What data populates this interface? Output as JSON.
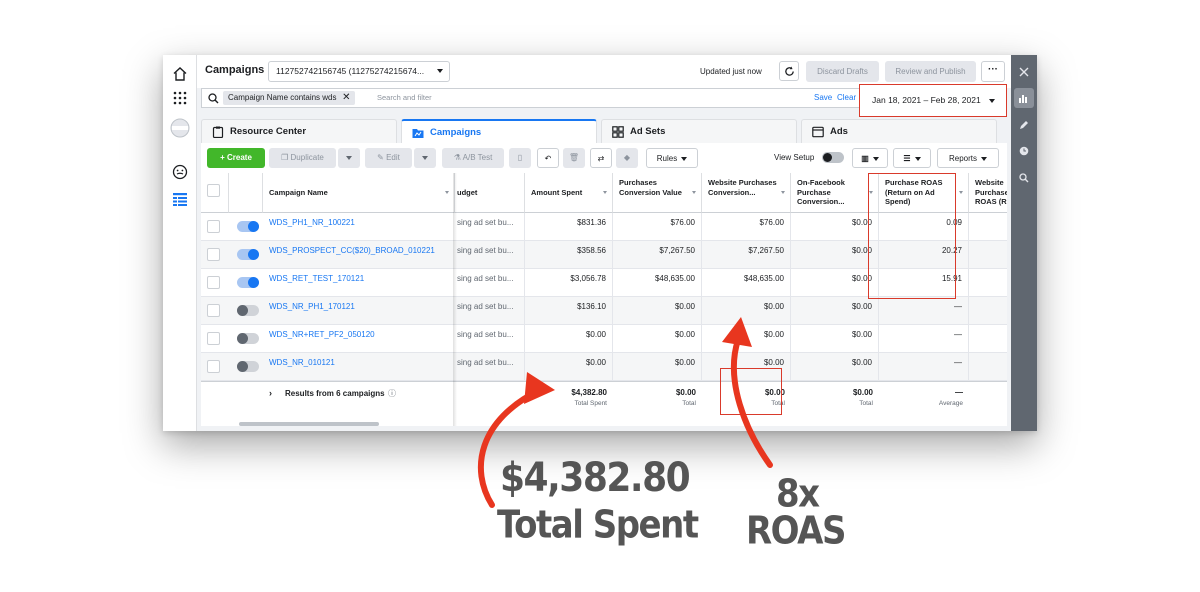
{
  "header": {
    "title": "Campaigns",
    "campaign_select": "112752742156745 (11275274215674...",
    "updated": "Updated just now",
    "discard": "Discard Drafts",
    "review": "Review and Publish",
    "more": "···"
  },
  "filter": {
    "chip": "Campaign Name contains wds",
    "placeholder": "Search and filter",
    "save": "Save",
    "clear": "Clear",
    "date_range": "Jan 18, 2021 – Feb 28, 2021"
  },
  "tabs": [
    {
      "label": "Resource Center"
    },
    {
      "label": "Campaigns"
    },
    {
      "label": "Ad Sets"
    },
    {
      "label": "Ads"
    }
  ],
  "toolbar": {
    "create": "+  Create",
    "duplicate": "Duplicate",
    "edit": "Edit",
    "ab_test": "A/B Test",
    "rules": "Rules",
    "view_setup": "View Setup",
    "reports": "Reports"
  },
  "columns": {
    "name": "Campaign Name",
    "budget": "udget",
    "amount": "Amount Spent",
    "pcv": "Purchases Conversion Value",
    "wpcv": "Website Purchases Conversion...",
    "ofp": "On-Facebook Purchase Conversion...",
    "roas": "Purchase ROAS (Return on Ad Spend)",
    "wroas": "Website Purchase ROAS (R"
  },
  "rows": [
    {
      "name": "WDS_PH1_NR_100221",
      "on": true,
      "budget": "sing ad set bu...",
      "amount": "$831.36",
      "pcv": "$76.00",
      "wpcv": "$76.00",
      "ofp": "$0.00",
      "roas": "0.09"
    },
    {
      "name": "WDS_PROSPECT_CC($20)_BROAD_010221",
      "on": true,
      "budget": "sing ad set bu...",
      "amount": "$358.56",
      "pcv": "$7,267.50",
      "wpcv": "$7,267.50",
      "ofp": "$0.00",
      "roas": "20.27"
    },
    {
      "name": "WDS_RET_TEST_170121",
      "on": true,
      "budget": "sing ad set bu...",
      "amount": "$3,056.78",
      "pcv": "$48,635.00",
      "wpcv": "$48,635.00",
      "ofp": "$0.00",
      "roas": "15.91"
    },
    {
      "name": "WDS_NR_PH1_170121",
      "on": false,
      "budget": "sing ad set bu...",
      "amount": "$136.10",
      "pcv": "$0.00",
      "wpcv": "$0.00",
      "ofp": "$0.00",
      "roas": "—"
    },
    {
      "name": "WDS_NR+RET_PF2_050120",
      "on": false,
      "budget": "sing ad set bu...",
      "amount": "$0.00",
      "pcv": "$0.00",
      "wpcv": "$0.00",
      "ofp": "$0.00",
      "roas": "—"
    },
    {
      "name": "WDS_NR_010121",
      "on": false,
      "budget": "sing ad set bu...",
      "amount": "$0.00",
      "pcv": "$0.00",
      "wpcv": "$0.00",
      "ofp": "$0.00",
      "roas": "—"
    }
  ],
  "totals": {
    "label": "Results from 6 campaigns",
    "amount": "$4,382.80",
    "amount_sub": "Total Spent",
    "pcv": "$0.00",
    "pcv_sub": "Total",
    "wpcv": "$0.00",
    "wpcv_sub": "Total",
    "ofp": "$0.00",
    "ofp_sub": "Total",
    "roas": "—",
    "roas_sub": "Average"
  },
  "annotations": {
    "spent_value": "$4,382.80",
    "spent_label": "Total Spent",
    "roas_value": "8x",
    "roas_label": "ROAS"
  },
  "colors": {
    "accent": "#1877f2",
    "create": "#42b72a",
    "highlight": "#d93a2b",
    "arrow": "#e8361f",
    "annotation_text": "#555555"
  }
}
